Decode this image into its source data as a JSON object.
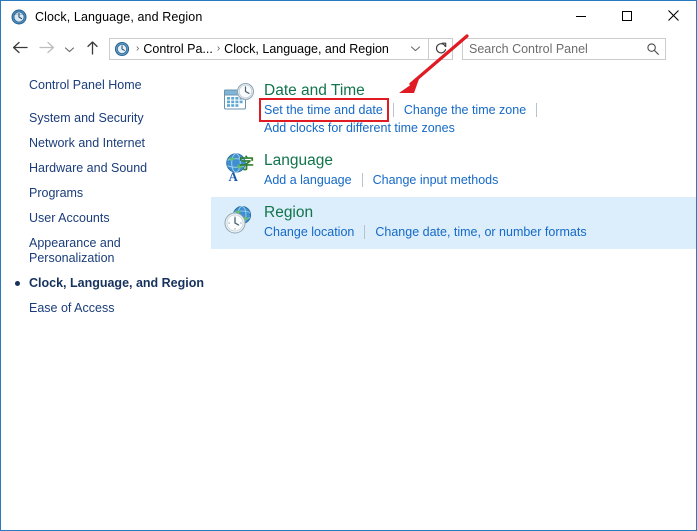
{
  "window": {
    "title": "Clock, Language, and Region",
    "title_icon": "clock-globe-icon",
    "controls": {
      "minimize": "minimize-icon",
      "maximize": "maximize-icon",
      "close": "close-icon"
    }
  },
  "toolbar": {
    "back": "back-arrow-icon",
    "forward": "forward-arrow-icon",
    "recent": "recent-locations-chevron-icon",
    "up": "up-arrow-icon",
    "refresh": "refresh-icon",
    "breadcrumb": {
      "icon": "control-panel-icon",
      "items": [
        "Control Pa...",
        "Clock, Language, and Region"
      ],
      "separator": "›",
      "dropdown": "breadcrumb-dropdown-chevron"
    },
    "search": {
      "placeholder": "Search Control Panel",
      "value": "",
      "icon": "search-icon"
    }
  },
  "sidebar": {
    "items": [
      {
        "label": "Control Panel Home",
        "selected": false,
        "home": true
      },
      {
        "label": "System and Security",
        "selected": false
      },
      {
        "label": "Network and Internet",
        "selected": false
      },
      {
        "label": "Hardware and Sound",
        "selected": false
      },
      {
        "label": "Programs",
        "selected": false
      },
      {
        "label": "User Accounts",
        "selected": false
      },
      {
        "label": "Appearance and Personalization",
        "selected": false
      },
      {
        "label": "Clock, Language, and Region",
        "selected": true
      },
      {
        "label": "Ease of Access",
        "selected": false
      }
    ]
  },
  "main": {
    "categories": [
      {
        "id": "date-and-time",
        "icon": "calendar-clock-icon",
        "title": "Date and Time",
        "hover": false,
        "links": [
          {
            "label": "Set the time and date",
            "annotated": true
          },
          {
            "label": "Change the time zone",
            "annotated": false
          }
        ],
        "trailing_divider": true,
        "sublinks": [
          {
            "label": "Add clocks for different time zones"
          }
        ]
      },
      {
        "id": "language",
        "icon": "globe-language-icon",
        "title": "Language",
        "hover": false,
        "links": [
          {
            "label": "Add a language",
            "annotated": false
          },
          {
            "label": "Change input methods",
            "annotated": false
          }
        ],
        "trailing_divider": false,
        "sublinks": []
      },
      {
        "id": "region",
        "icon": "clock-globe-region-icon",
        "title": "Region",
        "hover": true,
        "links": [
          {
            "label": "Change location",
            "annotated": false
          },
          {
            "label": "Change date, time, or number formats",
            "annotated": false
          }
        ],
        "trailing_divider": false,
        "sublinks": []
      }
    ]
  },
  "annotations": {
    "arrow": {
      "name": "red-arrow-annotation",
      "color": "#e01b24"
    },
    "box": {
      "name": "red-highlight-box",
      "color": "#e01b24",
      "target": "Set the time and date"
    }
  },
  "colors": {
    "window_border": "#2a7ac0",
    "category_title": "#11744b",
    "link": "#1569c7",
    "sidebar_link": "#1b3d7a",
    "hover_row": "#dceefb",
    "annotation_red": "#e01b24"
  }
}
